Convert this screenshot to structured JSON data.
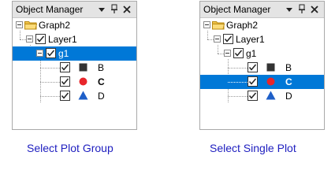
{
  "panels": {
    "left": {
      "title": "Object Manager",
      "graph_label": "Graph2",
      "layer_label": "Layer1",
      "group_label": "g1",
      "plots": [
        {
          "label": "B",
          "symbol": "square-icon",
          "color": "#333333"
        },
        {
          "label": "C",
          "symbol": "circle-icon",
          "color": "#e8252b"
        },
        {
          "label": "D",
          "symbol": "triangle-icon",
          "color": "#1e5fc8"
        }
      ]
    },
    "right": {
      "title": "Object Manager",
      "graph_label": "Graph2",
      "layer_label": "Layer1",
      "group_label": "g1",
      "plots": [
        {
          "label": "B",
          "symbol": "square-icon",
          "color": "#333333"
        },
        {
          "label": "C",
          "symbol": "circle-icon",
          "color": "#e8252b"
        },
        {
          "label": "D",
          "symbol": "triangle-icon",
          "color": "#1e5fc8"
        }
      ]
    }
  },
  "captions": {
    "left": "Select Plot Group",
    "right": "Select Single Plot"
  },
  "colors": {
    "selection": "#0078d7",
    "caption": "#2020c0",
    "folder": "#f0c34a"
  }
}
